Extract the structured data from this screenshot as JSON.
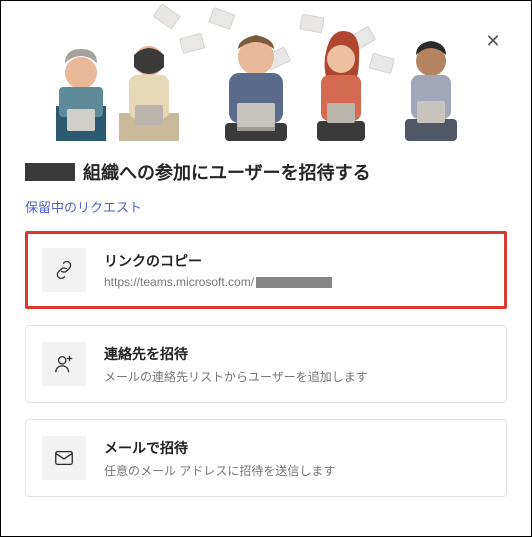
{
  "dialog": {
    "title": "組織への参加にユーザーを招待する",
    "pending_link": "保留中のリクエスト",
    "close_label": "✕"
  },
  "cards": {
    "copy_link": {
      "title": "リンクのコピー",
      "url_prefix": "https://teams.microsoft.com/"
    },
    "invite_contacts": {
      "title": "連絡先を招待",
      "subtitle": "メールの連絡先リストからユーザーを追加します"
    },
    "invite_email": {
      "title": "メールで招待",
      "subtitle": "任意のメール アドレスに招待を送信します"
    }
  }
}
